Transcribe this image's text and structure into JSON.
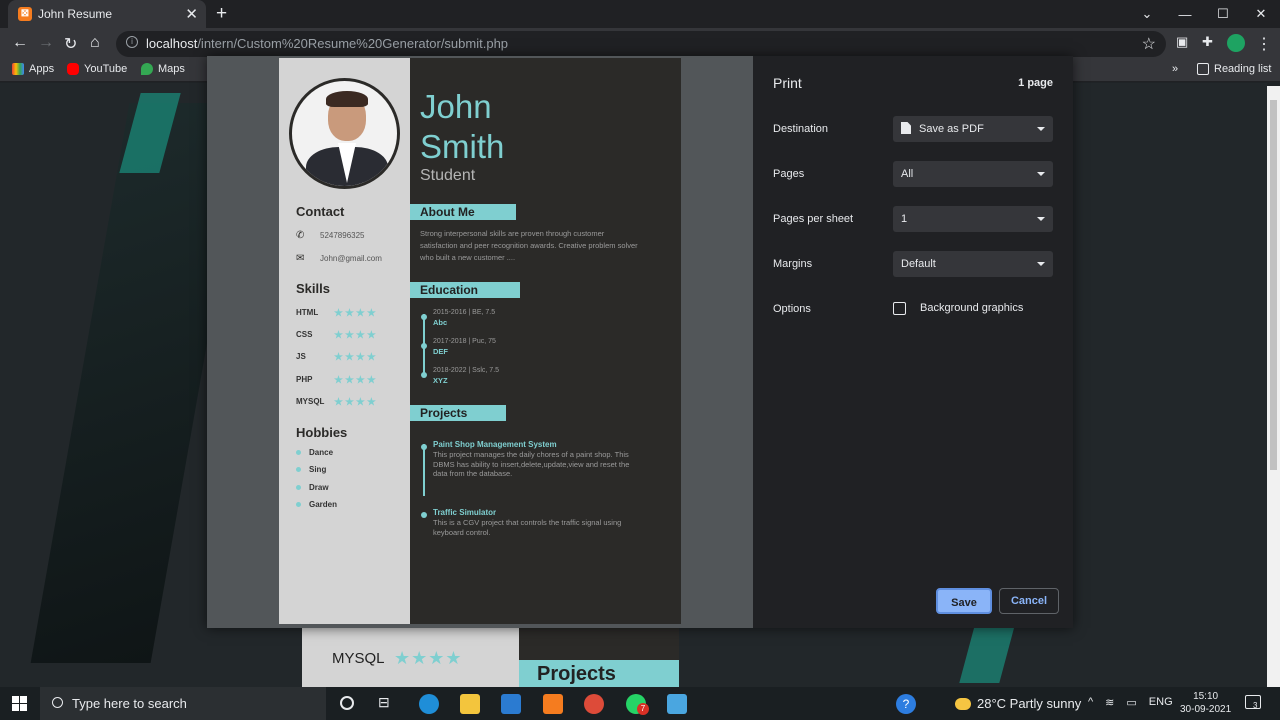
{
  "browser": {
    "tab_title": "John Resume",
    "url_host": "localhost",
    "url_path": "/intern/Custom%20Resume%20Generator/submit.php",
    "bookmarks": [
      "Apps",
      "YouTube",
      "Maps"
    ],
    "reading_list": "Reading list"
  },
  "resume": {
    "first_name": "John",
    "last_name": "Smith",
    "role": "Student",
    "contact_heading": "Contact",
    "phone": "5247896325",
    "email": "John@gmail.com",
    "skills_heading": "Skills",
    "skills": [
      "HTML",
      "CSS",
      "JS",
      "PHP",
      "MYSQL"
    ],
    "skill_stars": "★★★★",
    "hobbies_heading": "Hobbies",
    "hobbies": [
      "Dance",
      "Sing",
      "Draw",
      "Garden"
    ],
    "about_heading": "About Me",
    "about_text": "Strong interpersonal skills are proven through customer satisfaction and peer recognition awards. Creative problem solver who built a new customer ....",
    "education_heading": "Education",
    "education": [
      {
        "years": "2015-2016 | BE, 7.5",
        "name": "Abc"
      },
      {
        "years": "2017-2018 | Puc, 75",
        "name": "DEF"
      },
      {
        "years": "2018-2022 | Sslc, 7.5",
        "name": "XYZ"
      }
    ],
    "projects_heading": "Projects",
    "projects": [
      {
        "title": "Paint Shop Management System",
        "desc": "This project manages the daily chores of a paint shop. This DBMS has ability to insert,delete,update,view and reset the data from the database."
      },
      {
        "title": "Traffic Simulator",
        "desc": "This is a CGV project that controls the traffic signal using keyboard control."
      }
    ]
  },
  "background_page": {
    "skill_label": "MYSQL",
    "stars": "★★★★",
    "projects_heading": "Projects"
  },
  "print_dialog": {
    "title": "Print",
    "page_count": "1 page",
    "destination_label": "Destination",
    "destination_value": "Save as PDF",
    "pages_label": "Pages",
    "pages_value": "All",
    "pps_label": "Pages per sheet",
    "pps_value": "1",
    "margins_label": "Margins",
    "margins_value": "Default",
    "options_label": "Options",
    "bg_graphics_label": "Background graphics",
    "save_label": "Save",
    "cancel_label": "Cancel"
  },
  "taskbar": {
    "search_placeholder": "Type here to search",
    "weather": "28°C  Partly sunny",
    "language": "ENG",
    "time": "15:10",
    "date": "30-09-2021",
    "notification_count": "3",
    "whatsapp_badge": "7"
  }
}
